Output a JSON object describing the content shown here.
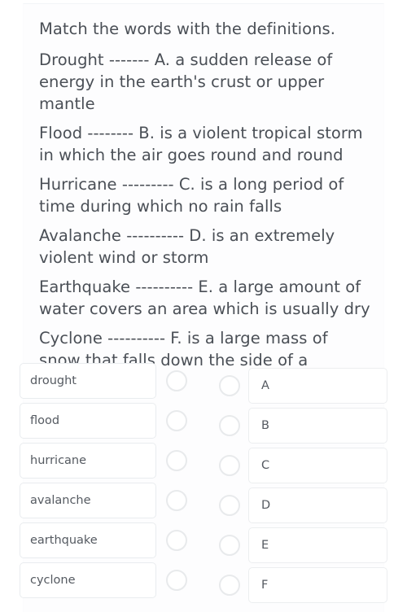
{
  "exercise": {
    "instruction": "Match the words with the definitions.",
    "pairs": [
      {
        "line": "Drought ------- A. a sudden release of energy in the earth's crust or upper mantle"
      },
      {
        "line": "Flood -------- B. is a violent tropical storm in which the air goes round and round"
      },
      {
        "line": "Hurricane --------- C. is a long period of time during which no rain falls"
      },
      {
        "line": "Avalanche ---------- D. is an extremely violent wind or storm"
      },
      {
        "line": "Earthquake ---------- E. a large amount of water covers an area which is usually dry"
      },
      {
        "line": "Cyclone ---------- F. is a large mass of snow that falls down the side of a mountain"
      }
    ]
  },
  "matching": {
    "rows": [
      {
        "word": "drought",
        "letter": "A"
      },
      {
        "word": "flood",
        "letter": "B"
      },
      {
        "word": "hurricane",
        "letter": "C"
      },
      {
        "word": "avalanche",
        "letter": "D"
      },
      {
        "word": "earthquake",
        "letter": "E"
      },
      {
        "word": "cyclone",
        "letter": "F"
      }
    ]
  },
  "colors": {
    "text": "#4a4f56",
    "box_border": "#e9ecef",
    "radio_border": "#e8eaec",
    "background": "#ffffff"
  }
}
